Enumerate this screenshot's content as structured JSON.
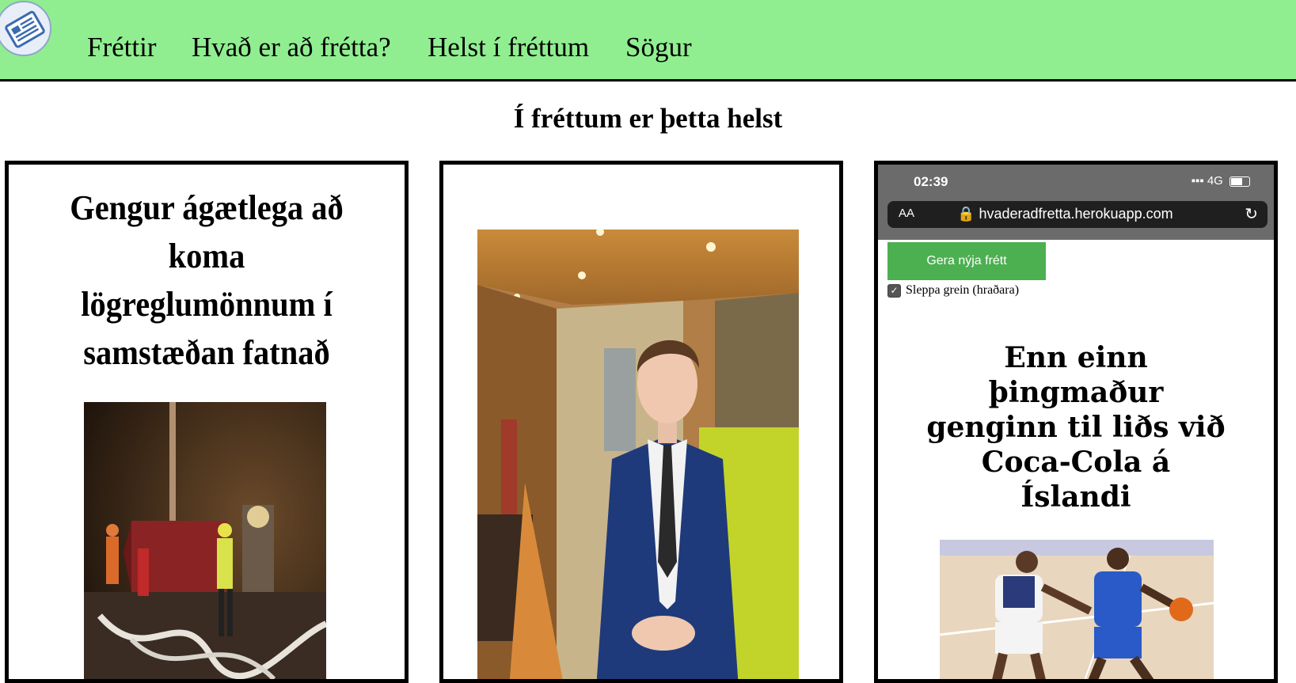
{
  "nav": {
    "logo_icon": "newspaper-icon",
    "items": [
      {
        "label": "Fréttir"
      },
      {
        "label": "Hvað er að frétta?"
      },
      {
        "label": "Helst í fréttum"
      },
      {
        "label": "Sögur"
      }
    ]
  },
  "page": {
    "title": "Í fréttum er þetta helst"
  },
  "cards": [
    {
      "heading": "Gengur ágætlega að koma lögreglumönnum í samstæðan fatnað",
      "image": "rescue-workers-at-night-photo"
    },
    {
      "heading": "",
      "image": "man-in-suit-portrait-photo"
    },
    {
      "image": "phone-screenshot",
      "phone": {
        "time": "02:39",
        "network": "4G",
        "text_size_label": "AA",
        "url": "hvaderadfretta.herokuapp.com",
        "new_button_label": "Gera nýja frétt",
        "skip_label": "Sleppa grein (hraðara)",
        "skip_checked": true
      },
      "heading": "Enn einn þingmaður genginn til liðs við Coca-Cola á Íslandi",
      "photo": "basketball-players-photo"
    }
  ]
}
